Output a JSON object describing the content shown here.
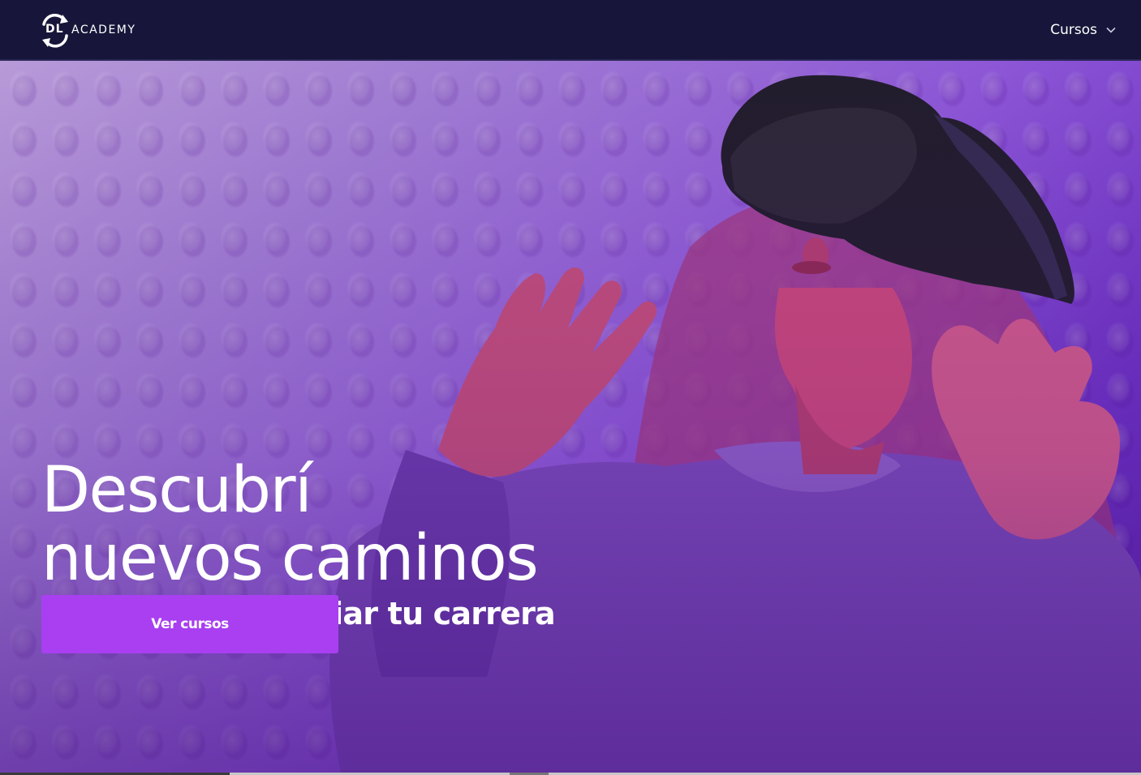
{
  "brand": {
    "logo_mark": "DL",
    "logo_text": "ACADEMY"
  },
  "nav": {
    "menu_label": "Cursos",
    "menu_icon": "chevron-down-icon"
  },
  "hero": {
    "headline_line1": "Descubrí",
    "headline_line2": "nuevos caminos",
    "subheadline": "y empezá a cambiar tu carrera",
    "cta_label": "Ver cursos",
    "image_subject": "woman-wearing-vr-headset"
  },
  "colors": {
    "navbar": "#17163a",
    "cta": "#a93ff0",
    "hero_tint": "#8c55d6",
    "text": "#ffffff"
  }
}
